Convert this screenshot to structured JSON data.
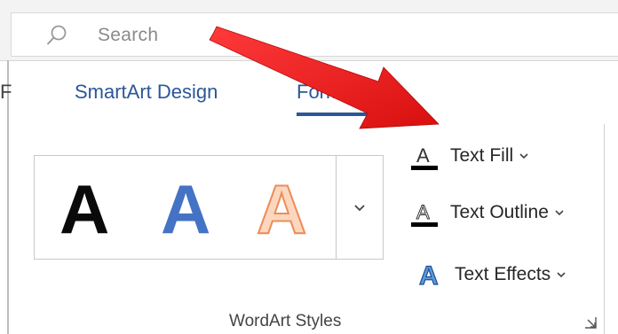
{
  "search": {
    "placeholder": "Search"
  },
  "ribbon": {
    "tabs": [
      {
        "label": "F"
      },
      {
        "label": "SmartArt Design"
      },
      {
        "label": "Format"
      }
    ],
    "wordart_gallery": {
      "styles": [
        {
          "letter": "A",
          "color": "#0a0a0a"
        },
        {
          "letter": "A",
          "color": "#4472c4"
        },
        {
          "letter": "A",
          "color": "#ee8c54"
        }
      ]
    },
    "commands": [
      {
        "label": "Text Fill",
        "icon": "text-fill-icon"
      },
      {
        "label": "Text Outline",
        "icon": "text-outline-icon"
      },
      {
        "label": "Text Effects",
        "icon": "text-effects-icon"
      }
    ],
    "group_label": "WordArt Styles"
  },
  "colors": {
    "accent": "#2b5797",
    "annotation_arrow": "#ee1c1c"
  }
}
